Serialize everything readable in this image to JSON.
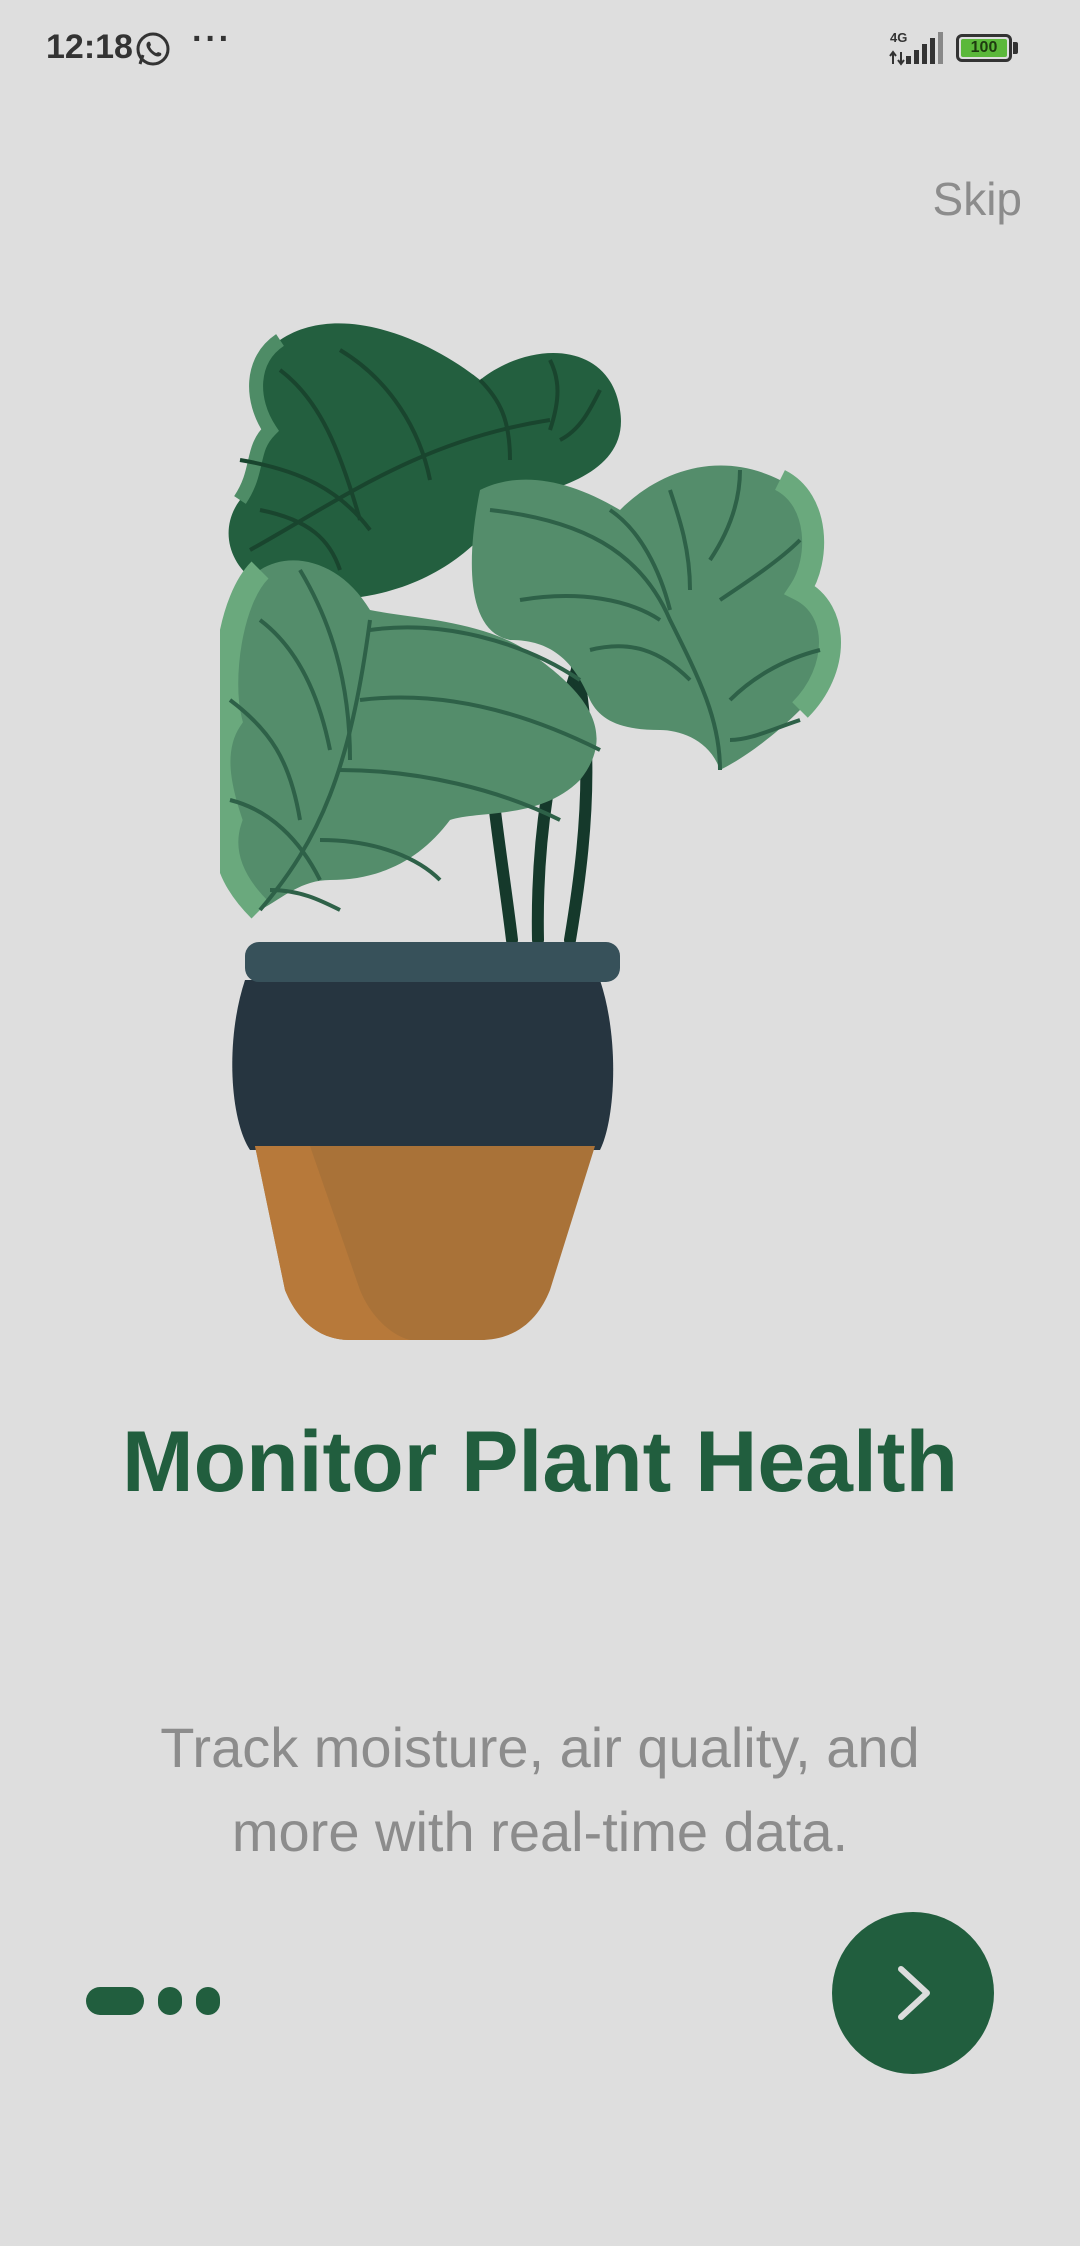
{
  "status_bar": {
    "time": "12:18",
    "more": "···",
    "network": "4G",
    "battery": "100",
    "icons": [
      "whatsapp-icon",
      "signal-icon",
      "battery-icon"
    ]
  },
  "header": {
    "skip_label": "Skip"
  },
  "onboarding": {
    "title": "Monitor Plant Health",
    "subtitle": "Track moisture, air quality, and more with real-time data.",
    "page_index": 1,
    "page_count": 3,
    "next_icon": "chevron-right-icon"
  },
  "colors": {
    "background": "#dedede",
    "primary": "#215e3e",
    "muted_text": "#8c8c8c",
    "leaf_dark": "#235f3f",
    "leaf_light": "#548d6b",
    "pot_dark": "#263540",
    "pot_terracotta": "#a97238"
  }
}
